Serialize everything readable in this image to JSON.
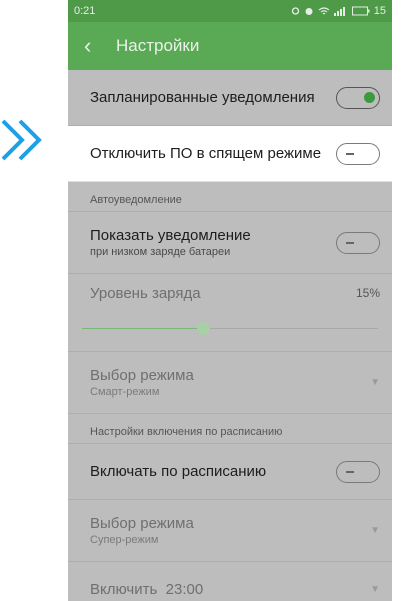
{
  "status": {
    "time": "0:21",
    "battery": "15"
  },
  "appbar": {
    "title": "Настройки"
  },
  "rows": {
    "scheduled": "Запланированные уведомления",
    "disable_sleep": "Отключить ПО в спящем режиме"
  },
  "sections": {
    "auto": "Автоуведомление",
    "schedule": "Настройки включения по расписанию"
  },
  "auto": {
    "show_title": "Показать уведомление",
    "show_sub": "при низком заряде батареи",
    "level_label": "Уровень заряда",
    "level_value": "15%",
    "level_fraction": 0.41,
    "mode_title": "Выбор режима",
    "mode_sub": "Смарт-режим"
  },
  "schedule": {
    "enable_label": "Включать по расписанию",
    "mode_title": "Выбор режима",
    "mode_sub": "Супер-режим",
    "on_label": "Включить",
    "on_time": "23:00"
  },
  "colors": {
    "accent": "#5aa955",
    "status": "#4e9a49",
    "annotation": "#1ea0e6"
  }
}
